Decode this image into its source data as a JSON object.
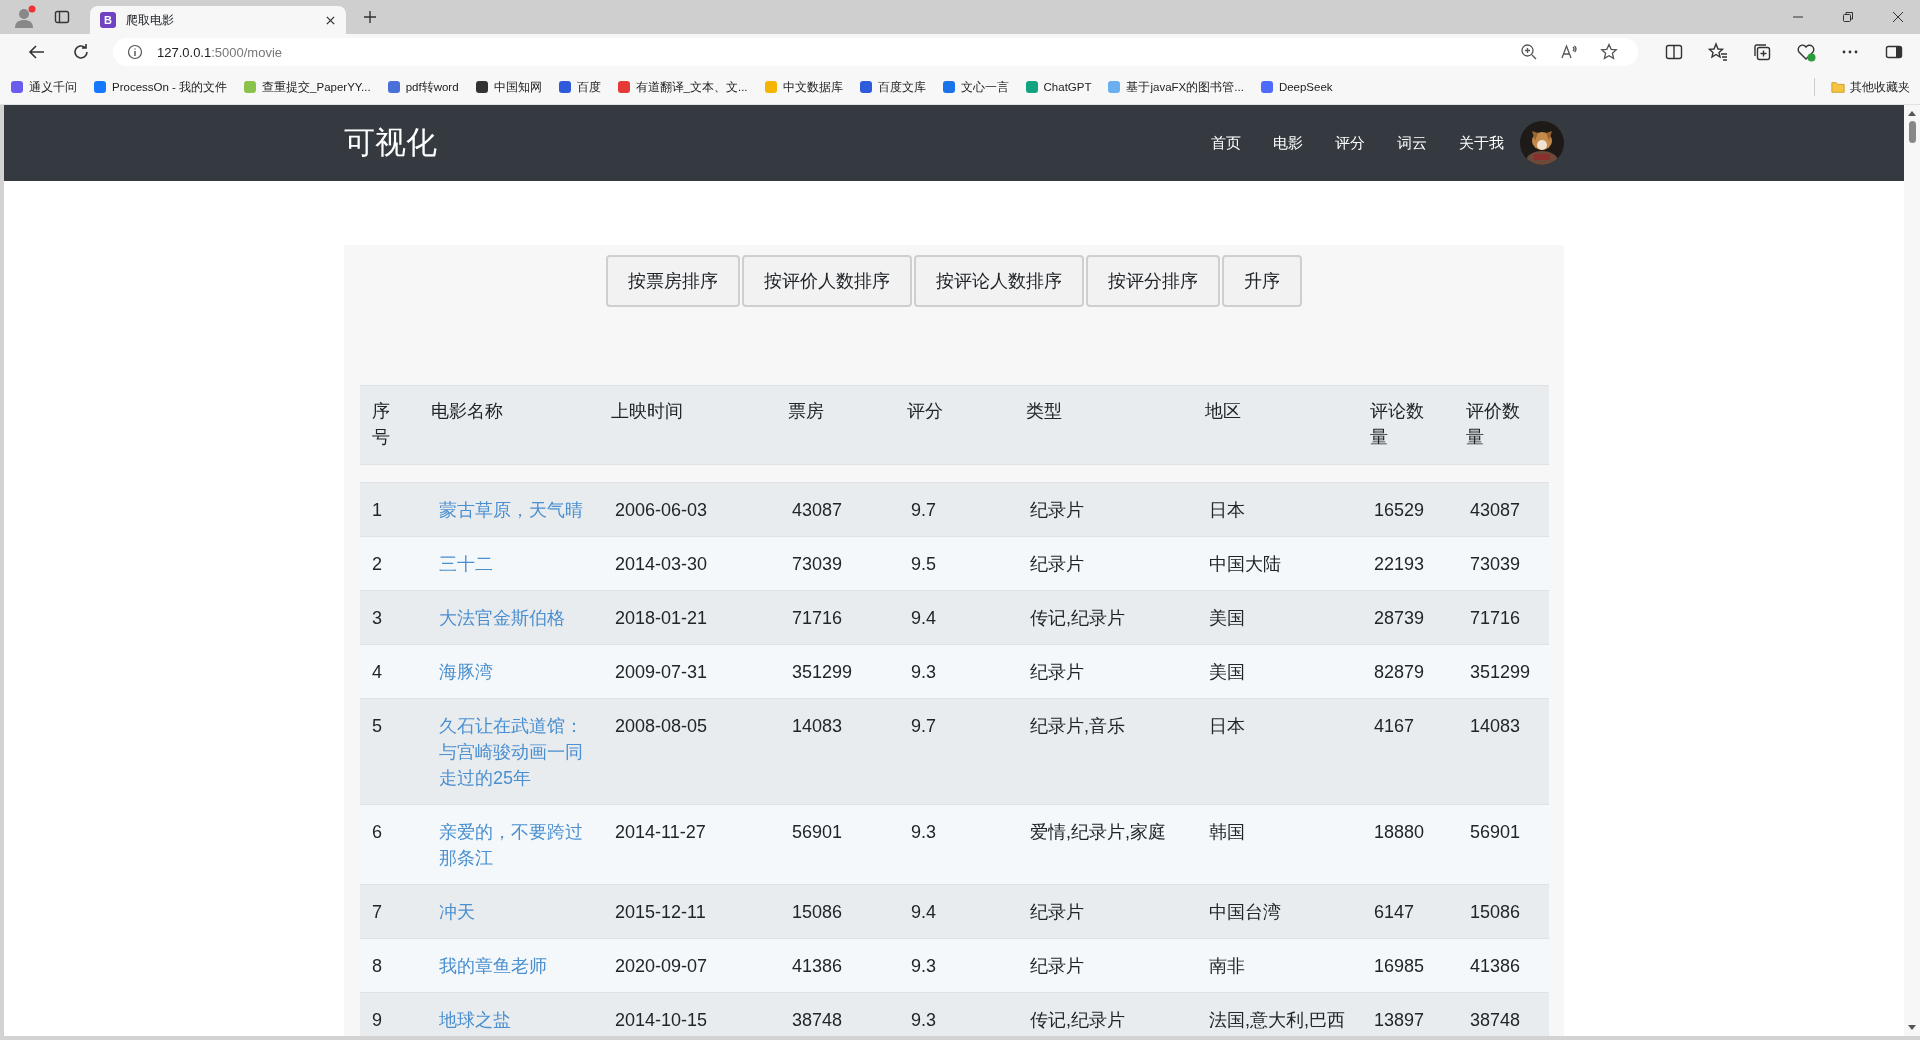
{
  "browser": {
    "tab": {
      "icon_text": "B",
      "title": "爬取电影"
    },
    "url_host": "127.0.0.1",
    "url_rest": ":5000/movie",
    "bookmarks": [
      {
        "label": "通义千问"
      },
      {
        "label": "ProcessOn - 我的文件"
      },
      {
        "label": "查重提交_PaperYY..."
      },
      {
        "label": "pdf转word"
      },
      {
        "label": "中国知网"
      },
      {
        "label": "百度"
      },
      {
        "label": "有道翻译_文本、文..."
      },
      {
        "label": "中文数据库"
      },
      {
        "label": "百度文库"
      },
      {
        "label": "文心一言"
      },
      {
        "label": "ChatGPT"
      },
      {
        "label": "基于javaFX的图书管..."
      },
      {
        "label": "DeepSeek"
      }
    ],
    "other_bookmarks": "其他收藏夹"
  },
  "navbar": {
    "brand": "可视化",
    "items": [
      "首页",
      "电影",
      "评分",
      "词云",
      "关于我"
    ]
  },
  "sort_buttons": [
    "按票房排序",
    "按评价人数排序",
    "按评论人数排序",
    "按评分排序",
    "升序"
  ],
  "table": {
    "columns": [
      "序号",
      "电影名称",
      "上映时间",
      "票房",
      "评分",
      "类型",
      "地区",
      "评论数量",
      "评价数量"
    ],
    "rows": [
      [
        "1",
        "蒙古草原，天气晴",
        "2006-06-03",
        "43087",
        "9.7",
        "纪录片",
        "日本",
        "16529",
        "43087"
      ],
      [
        "2",
        "三十二",
        "2014-03-30",
        "73039",
        "9.5",
        "纪录片",
        "中国大陆",
        "22193",
        "73039"
      ],
      [
        "3",
        "大法官金斯伯格",
        "2018-01-21",
        "71716",
        "9.4",
        "传记,纪录片",
        "美国",
        "28739",
        "71716"
      ],
      [
        "4",
        "海豚湾",
        "2009-07-31",
        "351299",
        "9.3",
        "纪录片",
        "美国",
        "82879",
        "351299"
      ],
      [
        "5",
        "久石让在武道馆：与宫崎骏动画一同走过的25年",
        "2008-08-05",
        "14083",
        "9.7",
        "纪录片,音乐",
        "日本",
        "4167",
        "14083"
      ],
      [
        "6",
        "亲爱的，不要跨过那条江",
        "2014-11-27",
        "56901",
        "9.3",
        "爱情,纪录片,家庭",
        "韩国",
        "18880",
        "56901"
      ],
      [
        "7",
        "冲天",
        "2015-12-11",
        "15086",
        "9.4",
        "纪录片",
        "中国台湾",
        "6147",
        "15086"
      ],
      [
        "8",
        "我的章鱼老师",
        "2020-09-07",
        "41386",
        "9.3",
        "纪录片",
        "南非",
        "16985",
        "41386"
      ],
      [
        "9",
        "地球之盐",
        "2014-10-15",
        "38748",
        "9.3",
        "传记,纪录片",
        "法国,意大利,巴西",
        "13897",
        "38748"
      ]
    ]
  }
}
